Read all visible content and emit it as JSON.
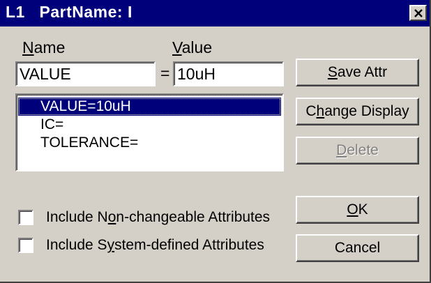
{
  "titlebar": {
    "title": "L1   PartName: I",
    "close_icon": "close-icon"
  },
  "fields": {
    "name_label_mnemonic": "N",
    "name_label_rest": "ame",
    "value_label_mnemonic": "V",
    "value_label_rest": "alue",
    "name_value": "VALUE",
    "equals": "=",
    "value_value": "10uH"
  },
  "attribute_list": {
    "items": [
      "VALUE=10uH",
      "IC=",
      "TOLERANCE="
    ],
    "selected_index": 0
  },
  "buttons": {
    "save_attr": {
      "mnemonic": "S",
      "rest": "ave Attr"
    },
    "change_display": {
      "pre": "C",
      "mnemonic": "h",
      "rest": "ange Display"
    },
    "delete": {
      "mnemonic": "D",
      "rest": "elete",
      "enabled": false
    },
    "ok": {
      "mnemonic": "O",
      "rest": "K"
    },
    "cancel": {
      "label": "Cancel"
    }
  },
  "checkboxes": {
    "non_changeable": {
      "pre": "Include N",
      "mnemonic": "o",
      "rest": "n-changeable Attributes",
      "checked": false
    },
    "system_defined": {
      "pre": "Include S",
      "mnemonic": "y",
      "rest": "stem-defined Attributes",
      "checked": false
    }
  },
  "colors": {
    "titlebar": "#00007b",
    "face": "#d4d0c8",
    "selection": "#00007b",
    "disabled_text": "#808080"
  }
}
